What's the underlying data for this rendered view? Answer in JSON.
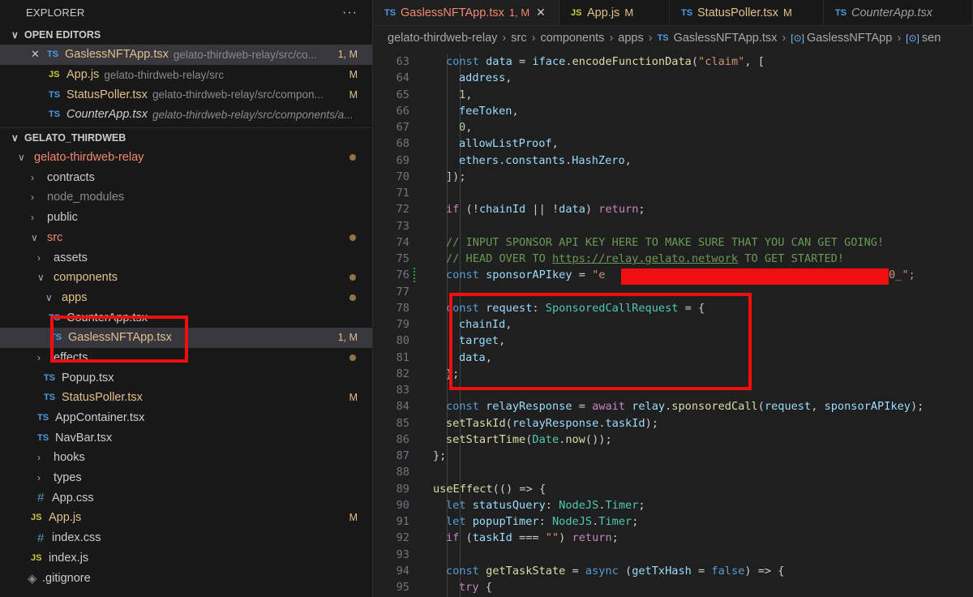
{
  "explorer": {
    "title": "EXPLORER",
    "more": "···",
    "open_editors_label": "OPEN EDITORS",
    "open_editors": [
      {
        "kind": "TS",
        "name": "GaslessNFTApp.tsx",
        "path": "gelato-thirdweb-relay/src/co...",
        "badge": "1, M",
        "state": "error",
        "close": "✕"
      },
      {
        "kind": "JS",
        "name": "App.js",
        "path": "gelato-thirdweb-relay/src",
        "badge": "M",
        "state": "mod"
      },
      {
        "kind": "TS",
        "name": "StatusPoller.tsx",
        "path": "gelato-thirdweb-relay/src/compon...",
        "badge": "M",
        "state": "mod"
      },
      {
        "kind": "TS",
        "name": "CounterApp.tsx",
        "path": "gelato-thirdweb-relay/src/components/a...",
        "badge": "",
        "state": "italic"
      }
    ],
    "workspace_label": "GELATO_THIRDWEB",
    "tree": [
      {
        "label": "gelato-thirdweb-relay",
        "chev": "∨",
        "color": "err",
        "dot": true
      },
      {
        "label": "contracts",
        "chev": "›"
      },
      {
        "label": "node_modules",
        "chev": "›",
        "color": "dimmed"
      },
      {
        "label": "public",
        "chev": "›"
      },
      {
        "label": "src",
        "chev": "∨",
        "color": "err",
        "dot": true
      },
      {
        "label": "assets",
        "chev": "›"
      },
      {
        "label": "components",
        "chev": "∨",
        "color": "mod",
        "dot": true
      },
      {
        "label": "apps",
        "chev": "∨",
        "color": "mod",
        "dot": true
      },
      {
        "label": "CounterApp.tsx",
        "kind": "TS"
      },
      {
        "label": "GaslessNFTApp.tsx",
        "kind": "TS",
        "color": "mod",
        "badge": "1, M"
      },
      {
        "label": "effects",
        "chev": "›",
        "dot": true
      },
      {
        "label": "Popup.tsx",
        "kind": "TS"
      },
      {
        "label": "StatusPoller.tsx",
        "kind": "TS",
        "color": "mod",
        "badge": "M"
      },
      {
        "label": "AppContainer.tsx",
        "kind": "TS"
      },
      {
        "label": "NavBar.tsx",
        "kind": "TS"
      },
      {
        "label": "hooks",
        "chev": "›"
      },
      {
        "label": "types",
        "chev": "›"
      },
      {
        "label": "App.css",
        "kind": "#"
      },
      {
        "label": "App.js",
        "kind": "JS",
        "color": "mod",
        "badge": "M"
      },
      {
        "label": "index.css",
        "kind": "#"
      },
      {
        "label": "index.js",
        "kind": "JS"
      },
      {
        "label": ".gitignore",
        "kind": "git"
      }
    ]
  },
  "tabs": [
    {
      "kind": "TS",
      "name": "GaslessNFTApp.tsx",
      "badge": "1, M",
      "close": "✕",
      "active": true
    },
    {
      "kind": "JS",
      "name": "App.js",
      "badge": "M"
    },
    {
      "kind": "TS",
      "name": "StatusPoller.tsx",
      "badge": "M"
    },
    {
      "kind": "TS",
      "name": "CounterApp.tsx",
      "badge": ""
    }
  ],
  "breadcrumb": [
    "gelato-thirdweb-relay",
    "src",
    "components",
    "apps",
    "GaslessNFTApp.tsx",
    "GaslessNFTApp",
    "sen"
  ],
  "code": {
    "line_numbers": [
      "63",
      "64",
      "65",
      "66",
      "67",
      "68",
      "69",
      "70",
      "71",
      "72",
      "73",
      "74",
      "75",
      "76",
      "77",
      "78",
      "79",
      "80",
      "81",
      "82",
      "83",
      "84",
      "85",
      "86",
      "87",
      "88",
      "89",
      "90",
      "91",
      "92",
      "93",
      "94",
      "95"
    ],
    "lines": [
      "const data = iface.encodeFunctionData(\"claim\", [",
      "address,",
      "1,",
      "feeToken,",
      "0,",
      "allowListProof,",
      "ethers.constants.HashZero,",
      "]);",
      "",
      "if (!chainId || !data) return;",
      "",
      "// INPUT SPONSOR API KEY HERE TO MAKE SURE THAT YOU CAN GET GOING!",
      "// HEAD OVER TO https://relay.gelato.network TO GET STARTED!",
      "const sponsorAPIkey = \"e",
      "",
      "const request: SponsoredCallRequest = {",
      "chainId,",
      "target,",
      "data,",
      "};",
      "",
      "const relayResponse = await relay.sponsoredCall(request, sponsorAPIkey);",
      "setTaskId(relayResponse.taskId);",
      "setStartTime(Date.now());",
      "};",
      "",
      "useEffect(() => {",
      "let statusQuery: NodeJS.Timer;",
      "let popupTimer: NodeJS.Timer;",
      "if (taskId === \"\") return;",
      "",
      "const getTaskState = async (getTxHash = false) => {",
      "try {"
    ],
    "api_key_suffix": "0_\";",
    "link_text": "https://relay.gelato.network"
  },
  "colors": {
    "highlight": "#f20e0e",
    "accent_error": "#f48771",
    "modified": "#e2c08d"
  }
}
